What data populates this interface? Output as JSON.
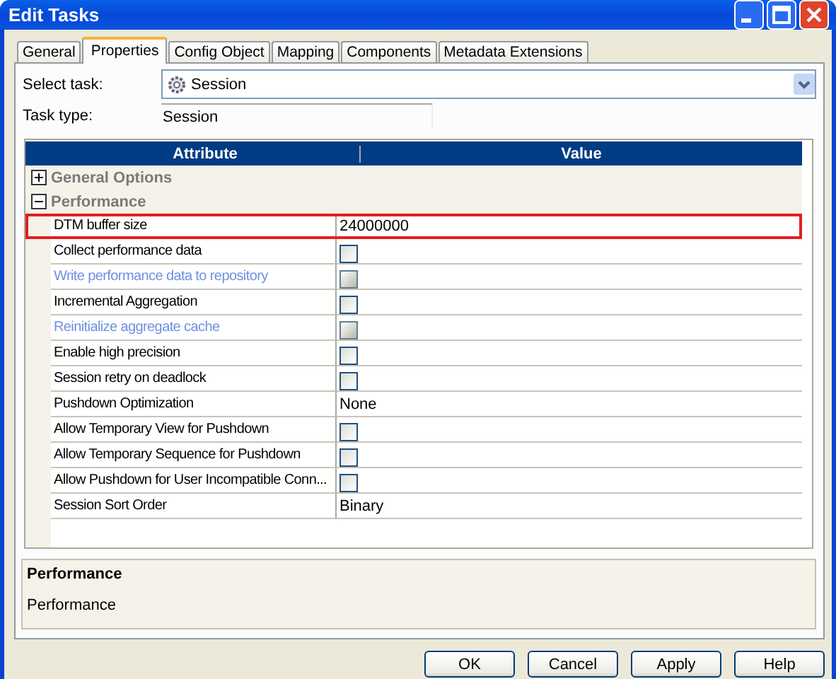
{
  "window": {
    "title": "Edit Tasks"
  },
  "tabs": [
    {
      "label": "General",
      "selected": false
    },
    {
      "label": "Properties",
      "selected": true
    },
    {
      "label": "Config Object",
      "selected": false
    },
    {
      "label": "Mapping",
      "selected": false
    },
    {
      "label": "Components",
      "selected": false
    },
    {
      "label": "Metadata Extensions",
      "selected": false
    }
  ],
  "select_task": {
    "label": "Select task:",
    "value": "Session"
  },
  "task_type": {
    "label": "Task type:",
    "value": "Session"
  },
  "table": {
    "columns": [
      "Attribute",
      "Value"
    ],
    "groups": [
      {
        "label": "General Options",
        "expanded": false
      },
      {
        "label": "Performance",
        "expanded": true,
        "children": [
          {
            "kind": "text",
            "name": "DTM buffer size",
            "value": "24000000",
            "selected": true,
            "disabled": false
          },
          {
            "kind": "checkbox",
            "name": "Collect performance data",
            "checked": false,
            "selected": false,
            "disabled": false
          },
          {
            "kind": "checkbox",
            "name": "Write performance data to repository",
            "checked": false,
            "selected": false,
            "disabled": true
          },
          {
            "kind": "checkbox",
            "name": "Incremental Aggregation",
            "checked": false,
            "selected": false,
            "disabled": false
          },
          {
            "kind": "checkbox",
            "name": "Reinitialize aggregate cache",
            "checked": false,
            "selected": false,
            "disabled": true
          },
          {
            "kind": "checkbox",
            "name": "Enable high precision",
            "checked": false,
            "selected": false,
            "disabled": false
          },
          {
            "kind": "checkbox",
            "name": "Session retry on deadlock",
            "checked": false,
            "selected": false,
            "disabled": false
          },
          {
            "kind": "text",
            "name": "Pushdown Optimization",
            "value": "None",
            "selected": false,
            "disabled": false
          },
          {
            "kind": "checkbox",
            "name": "Allow Temporary View for Pushdown",
            "checked": false,
            "selected": false,
            "disabled": false
          },
          {
            "kind": "checkbox",
            "name": "Allow Temporary Sequence for Pushdown",
            "checked": false,
            "selected": false,
            "disabled": false
          },
          {
            "kind": "checkbox",
            "name": "Allow Pushdown for User Incompatible Conn...",
            "checked": false,
            "selected": false,
            "disabled": false
          },
          {
            "kind": "text",
            "name": "Session Sort Order",
            "value": "Binary",
            "selected": false,
            "disabled": false
          }
        ]
      }
    ]
  },
  "description": {
    "title": "Performance",
    "text": "Performance"
  },
  "buttons": [
    "OK",
    "Cancel",
    "Apply",
    "Help"
  ]
}
